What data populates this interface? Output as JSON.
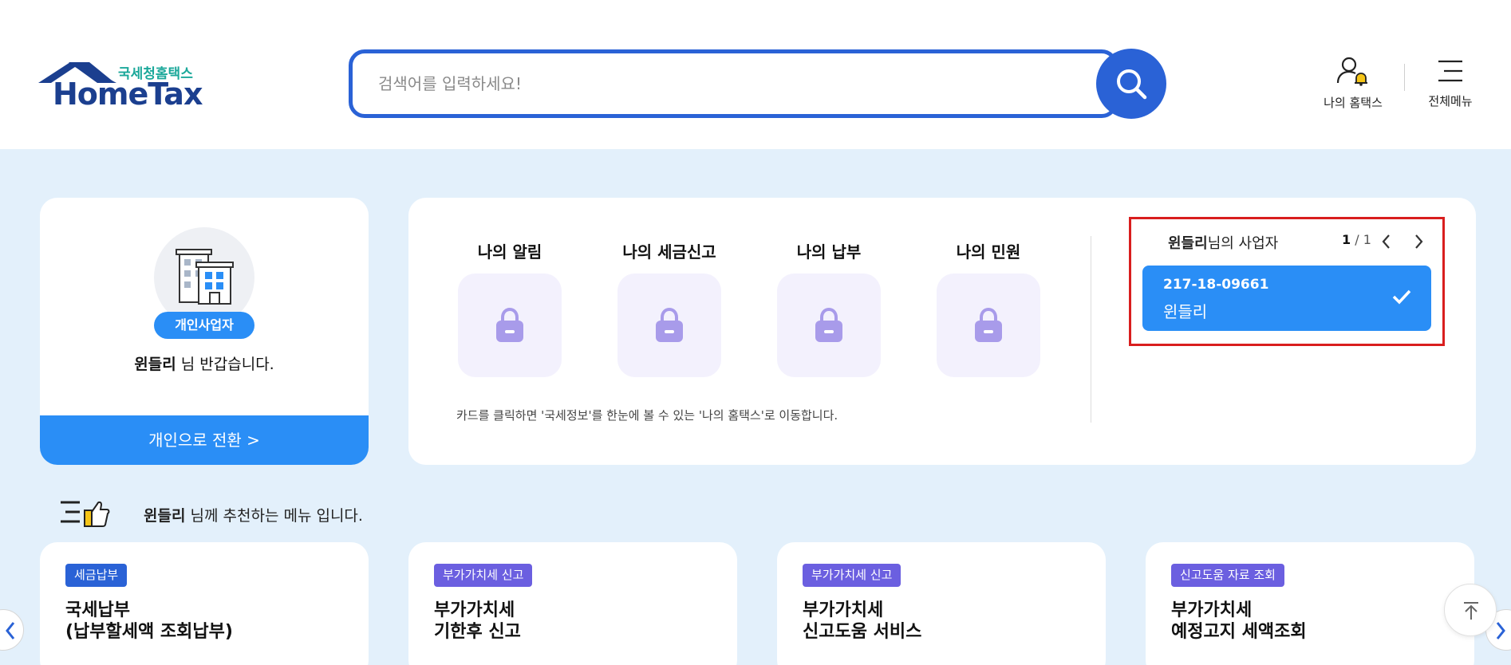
{
  "header": {
    "logo_kr": "국세청홈택스",
    "logo_en": "HomeTax",
    "search_placeholder": "검색어를 입력하세요!",
    "my_hometax_label": "나의 홈택스",
    "all_menu_label": "전체메뉴"
  },
  "profile": {
    "type_badge": "개인사업자",
    "user_name": "윈들리",
    "greeting_suffix": "님 반갑습니다.",
    "switch_button": "개인으로 전환 >"
  },
  "quick_menu": {
    "items": [
      {
        "title": "나의 알림"
      },
      {
        "title": "나의 세금신고"
      },
      {
        "title": "나의 납부"
      },
      {
        "title": "나의 민원"
      }
    ],
    "note": "카드를 클릭하면 '국세정보'를 한눈에 볼 수 있는 '나의 홈택스'로 이동합니다."
  },
  "business": {
    "owner_name": "윈들리",
    "title_suffix": "님의 사업자",
    "page_current": "1",
    "page_total": "/ 1",
    "selected": {
      "number": "217-18-09661",
      "name": "윈들리"
    }
  },
  "recommend": {
    "user_name": "윈들리",
    "heading_suffix": "님께 추천하는 메뉴 입니다.",
    "cards": [
      {
        "tag": "세금납부",
        "tag_color": "#2a62d6",
        "line1": "국세납부",
        "line2": "(납부할세액 조회납부)"
      },
      {
        "tag": "부가가치세 신고",
        "tag_color": "#6b5fe0",
        "line1": "부가가치세",
        "line2": "기한후 신고"
      },
      {
        "tag": "부가가치세 신고",
        "tag_color": "#6b5fe0",
        "line1": "부가가치세",
        "line2": "신고도움 서비스"
      },
      {
        "tag": "신고도움 자료 조회",
        "tag_color": "#6b5fe0",
        "line1": "부가가치세",
        "line2": "예정고지 세액조회"
      }
    ]
  },
  "colors": {
    "primary_blue": "#2a62d6",
    "action_blue": "#2a8ef6",
    "highlight_red": "#d91e1e",
    "lock_purple": "#a89bea",
    "background": "#e3f0fb"
  }
}
